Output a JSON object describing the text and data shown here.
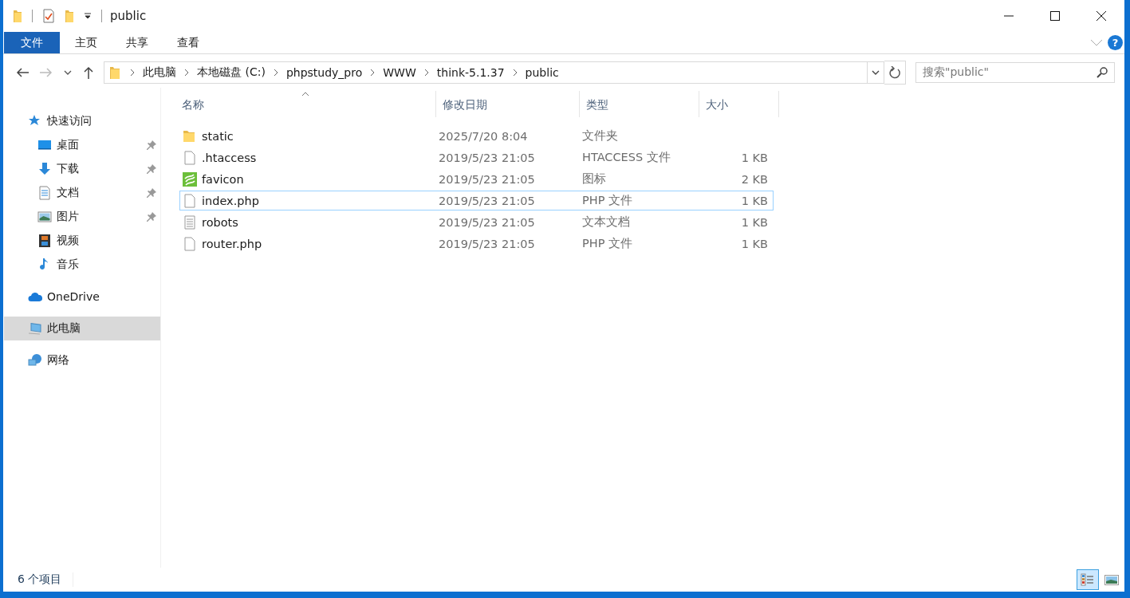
{
  "window": {
    "title": "public"
  },
  "ribbon": {
    "tabs": [
      {
        "label": "文件",
        "kind": "file"
      },
      {
        "label": "主页",
        "kind": "tab"
      },
      {
        "label": "共享",
        "kind": "tab"
      },
      {
        "label": "查看",
        "kind": "tab"
      }
    ],
    "help": "?"
  },
  "address": {
    "segments": [
      "此电脑",
      "本地磁盘 (C:)",
      "phpstudy_pro",
      "WWW",
      "think-5.1.37",
      "public"
    ]
  },
  "search": {
    "placeholder": "搜索\"public\""
  },
  "sidebar": {
    "items": [
      {
        "label": "快速访问",
        "kind": "star",
        "selected": false,
        "children": [
          {
            "label": "桌面",
            "kind": "desktop",
            "pinned": true,
            "selected": false
          },
          {
            "label": "下载",
            "kind": "download",
            "pinned": true,
            "selected": false
          },
          {
            "label": "文档",
            "kind": "document",
            "pinned": true,
            "selected": false
          },
          {
            "label": "图片",
            "kind": "picture",
            "pinned": true,
            "selected": false
          },
          {
            "label": "视频",
            "kind": "video",
            "pinned": false,
            "selected": false
          },
          {
            "label": "音乐",
            "kind": "music",
            "pinned": false,
            "selected": false
          }
        ]
      },
      {
        "label": "OneDrive",
        "kind": "cloud",
        "selected": false
      },
      {
        "label": "此电脑",
        "kind": "computer",
        "selected": true
      },
      {
        "label": "网络",
        "kind": "network",
        "selected": false
      }
    ]
  },
  "table": {
    "columns": [
      {
        "label": "名称",
        "sorted": true
      },
      {
        "label": "修改日期",
        "sorted": false
      },
      {
        "label": "类型",
        "sorted": false
      },
      {
        "label": "大小",
        "sorted": false
      }
    ],
    "rows": [
      {
        "name": "static",
        "date": "2025/7/20 8:04",
        "type": "文件夹",
        "size": "",
        "kind": "folder",
        "focused": false
      },
      {
        "name": ".htaccess",
        "date": "2019/5/23 21:05",
        "type": "HTACCESS 文件",
        "size": "1 KB",
        "kind": "blank",
        "focused": false
      },
      {
        "name": "favicon",
        "date": "2019/5/23 21:05",
        "type": "图标",
        "size": "2 KB",
        "kind": "image",
        "focused": false
      },
      {
        "name": "index.php",
        "date": "2019/5/23 21:05",
        "type": "PHP 文件",
        "size": "1 KB",
        "kind": "blank",
        "focused": true
      },
      {
        "name": "robots",
        "date": "2019/5/23 21:05",
        "type": "文本文档",
        "size": "1 KB",
        "kind": "text",
        "focused": false
      },
      {
        "name": "router.php",
        "date": "2019/5/23 21:05",
        "type": "PHP 文件",
        "size": "1 KB",
        "kind": "blank",
        "focused": false
      }
    ]
  },
  "status_bar": {
    "item_count": "6 个项目",
    "view_buttons": [
      {
        "kind": "details",
        "selected": true
      },
      {
        "kind": "large",
        "selected": false
      }
    ]
  }
}
